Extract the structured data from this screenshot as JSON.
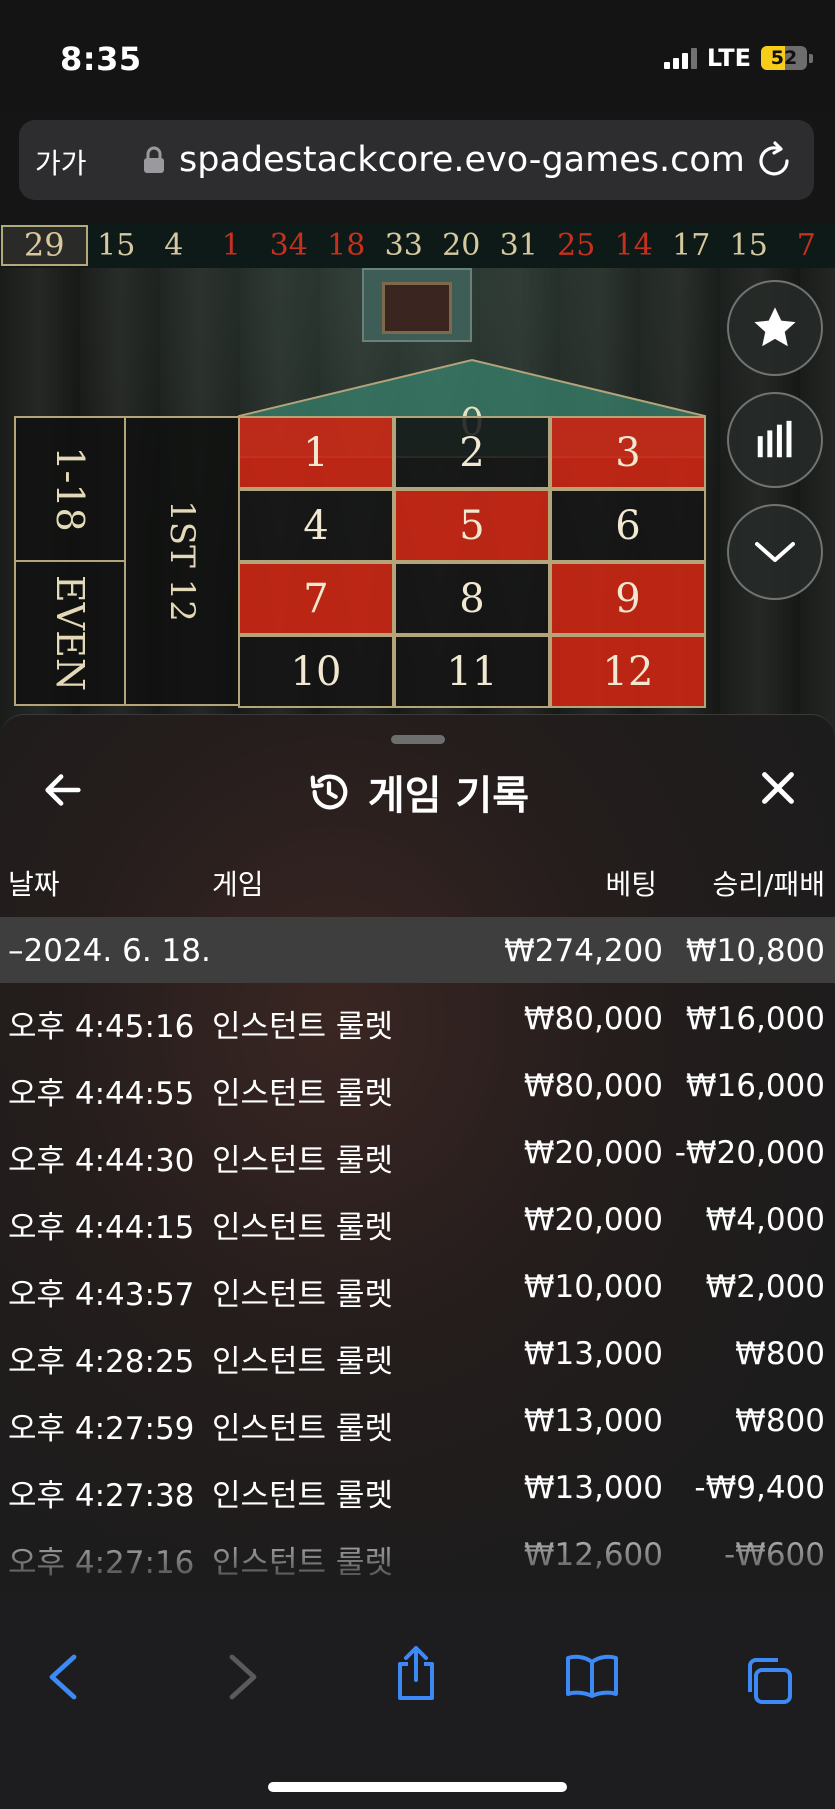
{
  "status_bar": {
    "time": "8:35",
    "network": "LTE",
    "battery": "52",
    "battery_level": 0.52
  },
  "browser": {
    "text_size_label": "가가",
    "url": "spadestackcore.evo-games.com"
  },
  "history_strip": {
    "current": "29",
    "numbers": [
      {
        "n": "15",
        "color": "black"
      },
      {
        "n": "4",
        "color": "black"
      },
      {
        "n": "1",
        "color": "red"
      },
      {
        "n": "34",
        "color": "red"
      },
      {
        "n": "18",
        "color": "red"
      },
      {
        "n": "33",
        "color": "black"
      },
      {
        "n": "20",
        "color": "black"
      },
      {
        "n": "31",
        "color": "black"
      },
      {
        "n": "25",
        "color": "red"
      },
      {
        "n": "14",
        "color": "red"
      },
      {
        "n": "17",
        "color": "black"
      },
      {
        "n": "15",
        "color": "black"
      },
      {
        "n": "7",
        "color": "red"
      }
    ]
  },
  "table": {
    "zero": "0",
    "numbers": [
      {
        "n": "1",
        "color": "red"
      },
      {
        "n": "2",
        "color": "black"
      },
      {
        "n": "3",
        "color": "red"
      },
      {
        "n": "4",
        "color": "black"
      },
      {
        "n": "5",
        "color": "red"
      },
      {
        "n": "6",
        "color": "black"
      },
      {
        "n": "7",
        "color": "red"
      },
      {
        "n": "8",
        "color": "black"
      },
      {
        "n": "9",
        "color": "red"
      },
      {
        "n": "10",
        "color": "black"
      },
      {
        "n": "11",
        "color": "black"
      },
      {
        "n": "12",
        "color": "red"
      }
    ],
    "range_bet": "1-18",
    "even_bet": "EVEN",
    "dozen_bet": "1ST 12"
  },
  "side_buttons": {
    "favorite": "star-icon",
    "stats": "bar-chart-icon",
    "collapse": "chevron-down-icon"
  },
  "sheet": {
    "title": "게임 기록",
    "columns": {
      "date": "날짜",
      "game": "게임",
      "bet": "베팅",
      "win_loss": "승리/패배"
    },
    "day_summary": {
      "date": "–2024. 6. 18.",
      "bet": "₩274,200",
      "win_loss": "₩10,800"
    },
    "rows": [
      {
        "time": "오후 4:45:16",
        "game": "인스턴트 룰렛",
        "bet": "₩80,000",
        "win_loss": "₩16,000"
      },
      {
        "time": "오후 4:44:55",
        "game": "인스턴트 룰렛",
        "bet": "₩80,000",
        "win_loss": "₩16,000"
      },
      {
        "time": "오후 4:44:30",
        "game": "인스턴트 룰렛",
        "bet": "₩20,000",
        "win_loss": "-₩20,000"
      },
      {
        "time": "오후 4:44:15",
        "game": "인스턴트 룰렛",
        "bet": "₩20,000",
        "win_loss": "₩4,000"
      },
      {
        "time": "오후 4:43:57",
        "game": "인스턴트 룰렛",
        "bet": "₩10,000",
        "win_loss": "₩2,000"
      },
      {
        "time": "오후 4:28:25",
        "game": "인스턴트 룰렛",
        "bet": "₩13,000",
        "win_loss": "₩800"
      },
      {
        "time": "오후 4:27:59",
        "game": "인스턴트 룰렛",
        "bet": "₩13,000",
        "win_loss": "₩800"
      },
      {
        "time": "오후 4:27:38",
        "game": "인스턴트 룰렛",
        "bet": "₩13,000",
        "win_loss": "-₩9,400"
      },
      {
        "time": "오후 4:27:16",
        "game": "인스턴트 룰렛",
        "bet": "₩12,600",
        "win_loss": "-₩600"
      }
    ]
  },
  "colors": {
    "red": "#c6301e",
    "black_text": "#d6c9a0",
    "safari_blue": "#3d8af7"
  }
}
